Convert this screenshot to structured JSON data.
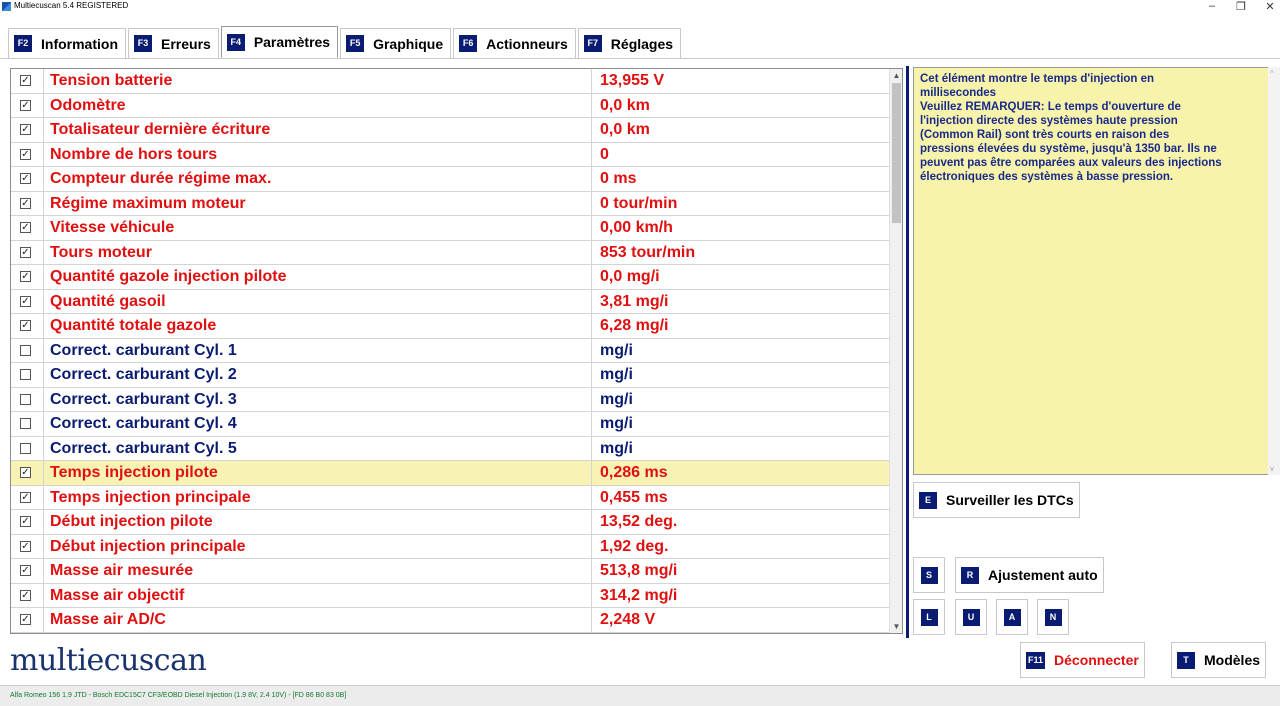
{
  "window": {
    "title": "Multiecuscan 5.4 REGISTERED",
    "minimize": "–",
    "restore": "❐",
    "close": "✕"
  },
  "tabs": [
    {
      "key": "F2",
      "label": "Information"
    },
    {
      "key": "F3",
      "label": "Erreurs"
    },
    {
      "key": "F4",
      "label": "Paramètres",
      "active": true
    },
    {
      "key": "F5",
      "label": "Graphique"
    },
    {
      "key": "F6",
      "label": "Actionneurs"
    },
    {
      "key": "F7",
      "label": "Réglages"
    }
  ],
  "parameters": [
    {
      "checked": true,
      "name": "Tension batterie",
      "value": "13,955 V",
      "color": "#e01010"
    },
    {
      "checked": true,
      "name": "Odomètre",
      "value": "0,0 km",
      "color": "#e01010"
    },
    {
      "checked": true,
      "name": "Totalisateur dernière écriture",
      "value": "0,0 km",
      "color": "#e01010"
    },
    {
      "checked": true,
      "name": "Nombre de hors tours",
      "value": "0",
      "color": "#e01010"
    },
    {
      "checked": true,
      "name": "Compteur durée régime max.",
      "value": "0 ms",
      "color": "#e01010"
    },
    {
      "checked": true,
      "name": "Régime maximum moteur",
      "value": "0 tour/min",
      "color": "#e01010"
    },
    {
      "checked": true,
      "name": "Vitesse véhicule",
      "value": "0,00 km/h",
      "color": "#e01010"
    },
    {
      "checked": true,
      "name": "Tours moteur",
      "value": "853 tour/min",
      "color": "#e01010"
    },
    {
      "checked": true,
      "name": "Quantité gazole injection pilote",
      "value": "0,0 mg/i",
      "color": "#e01010"
    },
    {
      "checked": true,
      "name": "Quantité gasoil",
      "value": "3,81 mg/i",
      "color": "#e01010"
    },
    {
      "checked": true,
      "name": "Quantité totale gazole",
      "value": "6,28 mg/i",
      "color": "#e01010"
    },
    {
      "checked": false,
      "name": "Correct. carburant Cyl. 1",
      "value": " mg/i",
      "color": "#0a1c72"
    },
    {
      "checked": false,
      "name": "Correct. carburant Cyl. 2",
      "value": " mg/i",
      "color": "#0a1c72"
    },
    {
      "checked": false,
      "name": "Correct. carburant Cyl. 3",
      "value": " mg/i",
      "color": "#0a1c72"
    },
    {
      "checked": false,
      "name": "Correct. carburant Cyl. 4",
      "value": " mg/i",
      "color": "#0a1c72"
    },
    {
      "checked": false,
      "name": "Correct. carburant Cyl. 5",
      "value": " mg/i",
      "color": "#0a1c72"
    },
    {
      "checked": true,
      "name": "Temps injection pilote",
      "value": "0,286 ms",
      "color": "#e01010",
      "selected": true
    },
    {
      "checked": true,
      "name": "Temps injection principale",
      "value": "0,455 ms",
      "color": "#e01010"
    },
    {
      "checked": true,
      "name": "Début injection pilote",
      "value": "13,52 deg.",
      "color": "#e01010"
    },
    {
      "checked": true,
      "name": "Début injection principale",
      "value": "1,92 deg.",
      "color": "#e01010"
    },
    {
      "checked": true,
      "name": "Masse air mesurée",
      "value": "513,8 mg/i",
      "color": "#e01010"
    },
    {
      "checked": true,
      "name": "Masse air objectif",
      "value": "314,2 mg/i",
      "color": "#e01010"
    },
    {
      "checked": true,
      "name": "Masse air AD/C",
      "value": "2,248 V",
      "color": "#e01010"
    }
  ],
  "info": {
    "text": "Cet élément montre le temps d'injection en\nmillisecondes\nVeuillez REMARQUER: Le temps d'ouverture de\nl'injection directe des systèmes haute pression\n(Common Rail) sont très courts en raison des\npressions élevées du système, jusqu'à 1350 bar. Ils ne\npeuvent pas être comparées aux valeurs des injections\nélectroniques des systèmes à basse pression."
  },
  "buttons": {
    "dtc": {
      "key": "E",
      "label": "Surveiller les DTCs"
    },
    "s": {
      "key": "S"
    },
    "auto": {
      "key": "R",
      "label": "Ajustement auto"
    },
    "l": {
      "key": "L"
    },
    "u": {
      "key": "U"
    },
    "a": {
      "key": "A"
    },
    "n": {
      "key": "N"
    },
    "disconnect": {
      "key": "F11",
      "label": "Déconnecter",
      "color": "#e01010"
    },
    "models": {
      "key": "T",
      "label": "Modèles"
    }
  },
  "logo": "multiecuscan",
  "status": "Alfa Romeo 156 1.9 JTD - Bosch EDC15C7 CF3/EOBD Diesel Injection (1.9 8V, 2.4 10V) - [FD 86 B0 83 0B]",
  "checkbox_glyph": "☑"
}
